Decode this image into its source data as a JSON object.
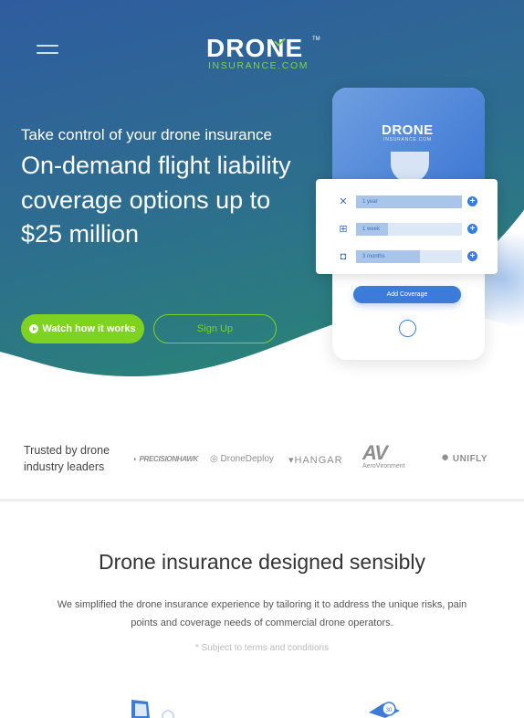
{
  "header": {
    "logo_main": "DRONE",
    "logo_sub": "INSURANCE.COM",
    "logo_tm": "TM"
  },
  "hero": {
    "tagline": "Take control of your drone insurance",
    "headline": "On-demand flight liability coverage options up to $25 million",
    "watch_label": "Watch how it works",
    "signup_label": "Sign Up"
  },
  "phone": {
    "logo_main": "DRONE",
    "logo_sub": "INSURANCE.COM",
    "rows": [
      {
        "label": "1 year",
        "icon": "drone-icon",
        "fill": 1.0
      },
      {
        "label": "1 week",
        "icon": "controller-icon",
        "fill": 0.3
      },
      {
        "label": "3 months",
        "icon": "camera-icon",
        "fill": 0.6
      }
    ],
    "add_label": "Add Coverage"
  },
  "trusted": {
    "label": "Trusted by drone industry leaders",
    "partners": [
      "PRECISIONHAWK",
      "DroneDeploy",
      "HANGAR",
      "AeroVironment",
      "UNIFLY"
    ]
  },
  "section": {
    "title": "Drone insurance designed sensibly",
    "text": "We simplified the drone insurance experience by tailoring it to address the unique risks, pain points and coverage needs of commercial drone operators.",
    "note": "* Subject to terms and conditions"
  },
  "colors": {
    "accent_green": "#7ed321",
    "brand_blue": "#3d7bd8",
    "hero_top": "#2f5f9e",
    "hero_bottom": "#2a7a7f"
  }
}
